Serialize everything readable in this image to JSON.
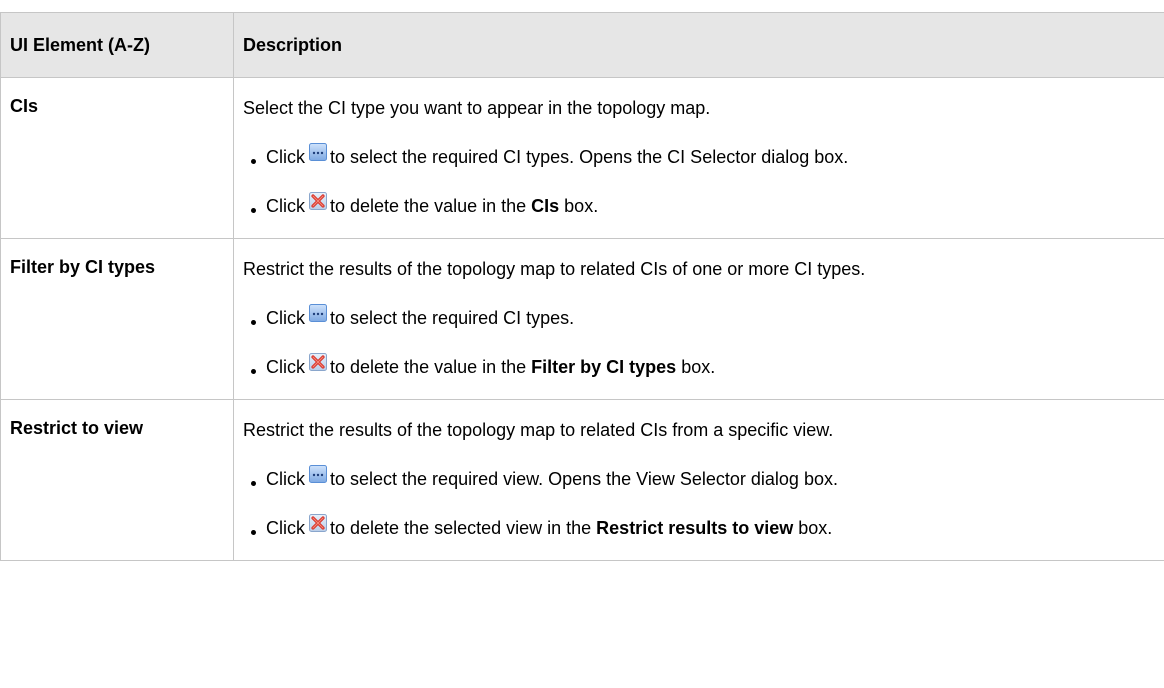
{
  "table": {
    "headers": [
      "UI Element (A-Z)",
      "Description"
    ],
    "rows": [
      {
        "name": "CIs",
        "lead": "Select the CI type you want to appear in the topology map.",
        "bullets": [
          {
            "prefix": "Click",
            "icon": "ellipsis-browse-icon",
            "text": "to select the required CI types. Opens the CI Selector dialog box.",
            "bold": "",
            "suffix": ""
          },
          {
            "prefix": "Click",
            "icon": "red-x-delete-icon",
            "text": "to delete the value in the ",
            "bold": "CIs",
            "suffix": " box."
          }
        ]
      },
      {
        "name": "Filter by CI types",
        "lead": "Restrict the results of the topology map to related CIs of one or more CI types.",
        "bullets": [
          {
            "prefix": "Click",
            "icon": "ellipsis-browse-icon",
            "text": "to select the required CI types.",
            "bold": "",
            "suffix": ""
          },
          {
            "prefix": "Click",
            "icon": "red-x-delete-icon",
            "text": "to delete the value in the ",
            "bold": "Filter by CI types",
            "suffix": " box."
          }
        ]
      },
      {
        "name": "Restrict to view",
        "lead": "Restrict the results of the topology map to related CIs from a specific view.",
        "bullets": [
          {
            "prefix": "Click",
            "icon": "ellipsis-browse-icon",
            "text": "to select the required view. Opens the View Selector dialog box.",
            "bold": "",
            "suffix": ""
          },
          {
            "prefix": "Click",
            "icon": "red-x-delete-icon",
            "text": "to delete the selected view in the ",
            "bold": "Restrict results to view",
            "suffix": " box."
          }
        ]
      }
    ]
  },
  "colors": {
    "header_bg": "#e6e6e6",
    "border": "#c6c6c6",
    "browse_icon_blue": "#5a8fd6",
    "delete_icon_red": "#d9342b"
  }
}
